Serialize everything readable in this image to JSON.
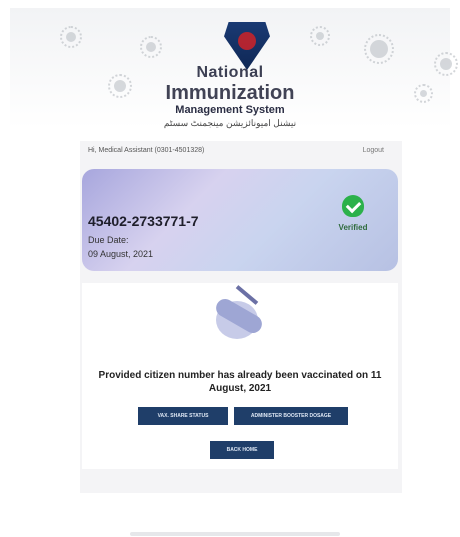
{
  "header": {
    "line1": "National",
    "line2": "Immunization",
    "line3": "Management System",
    "line4": "نیشنل امیونائزیشن مینجمنٹ سسٹم",
    "logo_icon": "shield-logo-icon"
  },
  "topbar": {
    "welcome": "Hi, Medical Assistant (0301-4501328)",
    "logout": "Logout"
  },
  "status_card": {
    "cnic": "45402-2733771-7",
    "due_date_label": "Due Date:",
    "due_date": "09 August, 2021",
    "status": "Verified",
    "status_icon": "verified-shield-icon",
    "status_color": "#2bb14a"
  },
  "main": {
    "illustration_icon": "vaccination-arm-icon",
    "message": "Provided citizen number has already been vaccinated on 11 August, 2021",
    "buttons": {
      "vaccination_status": "VAX. SHARE STATUS",
      "administer_booster": "ADMINISTER BOOSTER DOSAGE",
      "go_home": "BACK HOME"
    }
  },
  "colors": {
    "button_bg": "#1f3e69",
    "panel_bg": "#f4f4f6"
  }
}
